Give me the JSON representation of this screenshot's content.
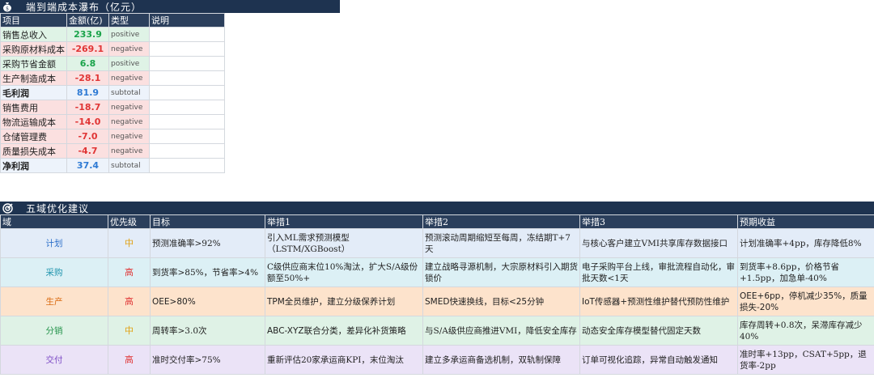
{
  "waterfall": {
    "title": "端到端成本瀑布（亿元）",
    "headers": [
      "项目",
      "金额(亿)",
      "类型",
      "说明"
    ],
    "rows": [
      {
        "item": "销售总收入",
        "amount": "233.9",
        "type": "positive"
      },
      {
        "item": "采购原材料成本",
        "amount": "-269.1",
        "type": "negative"
      },
      {
        "item": "采购节省金额",
        "amount": "6.8",
        "type": "positive"
      },
      {
        "item": "生产制造成本",
        "amount": "-28.1",
        "type": "negative"
      },
      {
        "item": "毛利润",
        "amount": "81.9",
        "type": "subtotal"
      },
      {
        "item": "销售费用",
        "amount": "-18.7",
        "type": "negative"
      },
      {
        "item": "物流运输成本",
        "amount": "-14.0",
        "type": "negative"
      },
      {
        "item": "仓储管理费",
        "amount": "-7.0",
        "type": "negative"
      },
      {
        "item": "质量损失成本",
        "amount": "-4.7",
        "type": "negative"
      },
      {
        "item": "净利润",
        "amount": "37.4",
        "type": "subtotal"
      }
    ]
  },
  "five_domain": {
    "title": "五域优化建议",
    "headers": [
      "域",
      "优先级",
      "目标",
      "举措1",
      "举措2",
      "举措3",
      "预期收益"
    ],
    "rows": [
      {
        "domain": "计划",
        "priority": "中",
        "goal": "预测准确率>92%",
        "a1": "引入ML需求预测模型（LSTM/XGBoost）",
        "a2": "预测滚动周期缩短至每周，冻结期T+7天",
        "a3": "与核心客户建立VMI共享库存数据接口",
        "benefit": "计划准确率+4pp，库存降低8%"
      },
      {
        "domain": "采购",
        "priority": "高",
        "goal": "到货率>85%，节省率>4%",
        "a1": "C级供应商末位10%淘汰，扩大S/A级份额至50%+",
        "a2": "建立战略寻源机制，大宗原材料引入期货锁价",
        "a3": "电子采购平台上线，审批流程自动化，审批天数<1天",
        "benefit": "到货率+8.6pp，价格节省+1.5pp，加急单-40%"
      },
      {
        "domain": "生产",
        "priority": "高",
        "goal": "OEE>80%",
        "a1": "TPM全员维护，建立分级保养计划",
        "a2": "SMED快速换线，目标<25分钟",
        "a3": "IoT传感器+预测性维护替代预防性维护",
        "benefit": "OEE+6pp，停机减少35%，质量损失-20%"
      },
      {
        "domain": "分销",
        "priority": "中",
        "goal": "周转率>3.0次",
        "a1": "ABC-XYZ联合分类，差异化补货策略",
        "a2": "与S/A级供应商推进VMI，降低安全库存",
        "a3": "动态安全库存模型替代固定天数",
        "benefit": "库存周转+0.8次，呆滞库存减少40%"
      },
      {
        "domain": "交付",
        "priority": "高",
        "goal": "准时交付率>75%",
        "a1": "重新评估20家承运商KPI，末位淘汰",
        "a2": "建立多承运商备选机制，双轨制保障",
        "a3": "订单可视化追踪，异常自动触发通知",
        "benefit": "准时率+13pp，CSAT+5pp，退货率-2pp"
      }
    ]
  }
}
